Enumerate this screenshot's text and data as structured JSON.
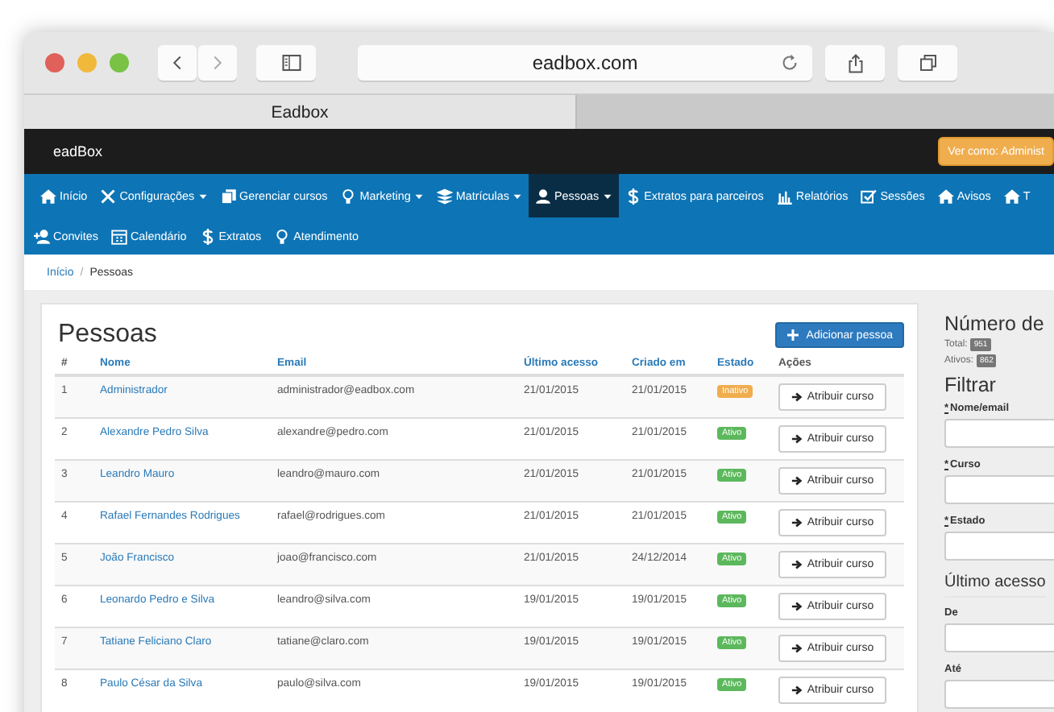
{
  "browser": {
    "url": "eadbox.com",
    "tab_title": "Eadbox"
  },
  "header": {
    "logo": "eadBox",
    "view_as": "Ver como: Administ"
  },
  "nav": {
    "rows": [
      [
        {
          "label": "Início",
          "dropdown": false,
          "selected": false
        },
        {
          "label": "Configurações",
          "dropdown": true,
          "selected": false
        },
        {
          "label": "Gerenciar cursos",
          "dropdown": false,
          "selected": false
        },
        {
          "label": "Marketing",
          "dropdown": true,
          "selected": false
        },
        {
          "label": "Matrículas",
          "dropdown": true,
          "selected": false
        },
        {
          "label": "Pessoas",
          "dropdown": true,
          "selected": true
        },
        {
          "label": "Extratos para parceiros",
          "dropdown": false,
          "selected": false
        },
        {
          "label": "Relatórios",
          "dropdown": false,
          "selected": false
        },
        {
          "label": "Sessões",
          "dropdown": false,
          "selected": false
        },
        {
          "label": "Avisos",
          "dropdown": false,
          "selected": false
        },
        {
          "label": "T",
          "dropdown": false,
          "selected": false
        }
      ],
      [
        {
          "label": "Convites",
          "dropdown": false,
          "selected": false
        },
        {
          "label": "Calendário",
          "dropdown": false,
          "selected": false
        },
        {
          "label": "Extratos",
          "dropdown": false,
          "selected": false
        },
        {
          "label": "Atendimento",
          "dropdown": false,
          "selected": false
        }
      ]
    ]
  },
  "breadcrumb": {
    "items": [
      "Início",
      "Pessoas"
    ],
    "separator": "/"
  },
  "people": {
    "title": "Pessoas",
    "add_button": "Adicionar pessoa",
    "columns": [
      {
        "label": "#",
        "link": false
      },
      {
        "label": "Nome",
        "link": true
      },
      {
        "label": "Email",
        "link": true
      },
      {
        "label": "Último acesso",
        "link": true
      },
      {
        "label": "Criado em",
        "link": true
      },
      {
        "label": "Estado",
        "link": true
      },
      {
        "label": "Ações",
        "link": false
      }
    ],
    "rows": [
      {
        "number": "1",
        "name": "Administrador",
        "email": "administrador@eadbox.com",
        "last_access": "21/01/2015",
        "created": "21/01/2015",
        "status": {
          "label": "Inativo",
          "color": "#f0ad4e"
        },
        "action": "Atribuir curso"
      },
      {
        "number": "2",
        "name": "Alexandre Pedro Silva",
        "email": "alexandre@pedro.com",
        "last_access": "21/01/2015",
        "created": "21/01/2015",
        "status": {
          "label": "Ativo",
          "color": "#5cb85c"
        },
        "action": "Atribuir curso"
      },
      {
        "number": "3",
        "name": "Leandro Mauro",
        "email": "leandro@mauro.com",
        "last_access": "21/01/2015",
        "created": "21/01/2015",
        "status": {
          "label": "Ativo",
          "color": "#5cb85c"
        },
        "action": "Atribuir curso"
      },
      {
        "number": "4",
        "name": "Rafael Fernandes Rodrigues",
        "email": "rafael@rodrigues.com",
        "last_access": "21/01/2015",
        "created": "21/01/2015",
        "status": {
          "label": "Ativo",
          "color": "#5cb85c"
        },
        "action": "Atribuir curso"
      },
      {
        "number": "5",
        "name": "João Francisco",
        "email": "joao@francisco.com",
        "last_access": "21/01/2015",
        "created": "24/12/2014",
        "status": {
          "label": "Ativo",
          "color": "#5cb85c"
        },
        "action": "Atribuir curso"
      },
      {
        "number": "6",
        "name": "Leonardo Pedro e Silva",
        "email": "leandro@silva.com",
        "last_access": "19/01/2015",
        "created": "19/01/2015",
        "status": {
          "label": "Ativo",
          "color": "#5cb85c"
        },
        "action": "Atribuir curso"
      },
      {
        "number": "7",
        "name": "Tatiane Feliciano Claro",
        "email": "tatiane@claro.com",
        "last_access": "19/01/2015",
        "created": "19/01/2015",
        "status": {
          "label": "Ativo",
          "color": "#5cb85c"
        },
        "action": "Atribuir curso"
      },
      {
        "number": "8",
        "name": "Paulo César da Silva",
        "email": "paulo@silva.com",
        "last_access": "19/01/2015",
        "created": "19/01/2015",
        "status": {
          "label": "Ativo",
          "color": "#5cb85c"
        },
        "action": "Atribuir curso"
      }
    ]
  },
  "sidebar": {
    "count_title": "Número de",
    "counts": [
      {
        "label": "Total:",
        "value": "951"
      },
      {
        "label": "Ativos:",
        "value": "862"
      }
    ],
    "filter_title": "Filtrar",
    "required_mark": "*",
    "fields": [
      {
        "label": "Nome/email",
        "required": true
      },
      {
        "label": "Curso",
        "required": true
      },
      {
        "label": "Estado",
        "required": true
      }
    ],
    "section": "Último acesso",
    "date_fields": [
      {
        "label": "De"
      },
      {
        "label": "Até"
      }
    ]
  }
}
